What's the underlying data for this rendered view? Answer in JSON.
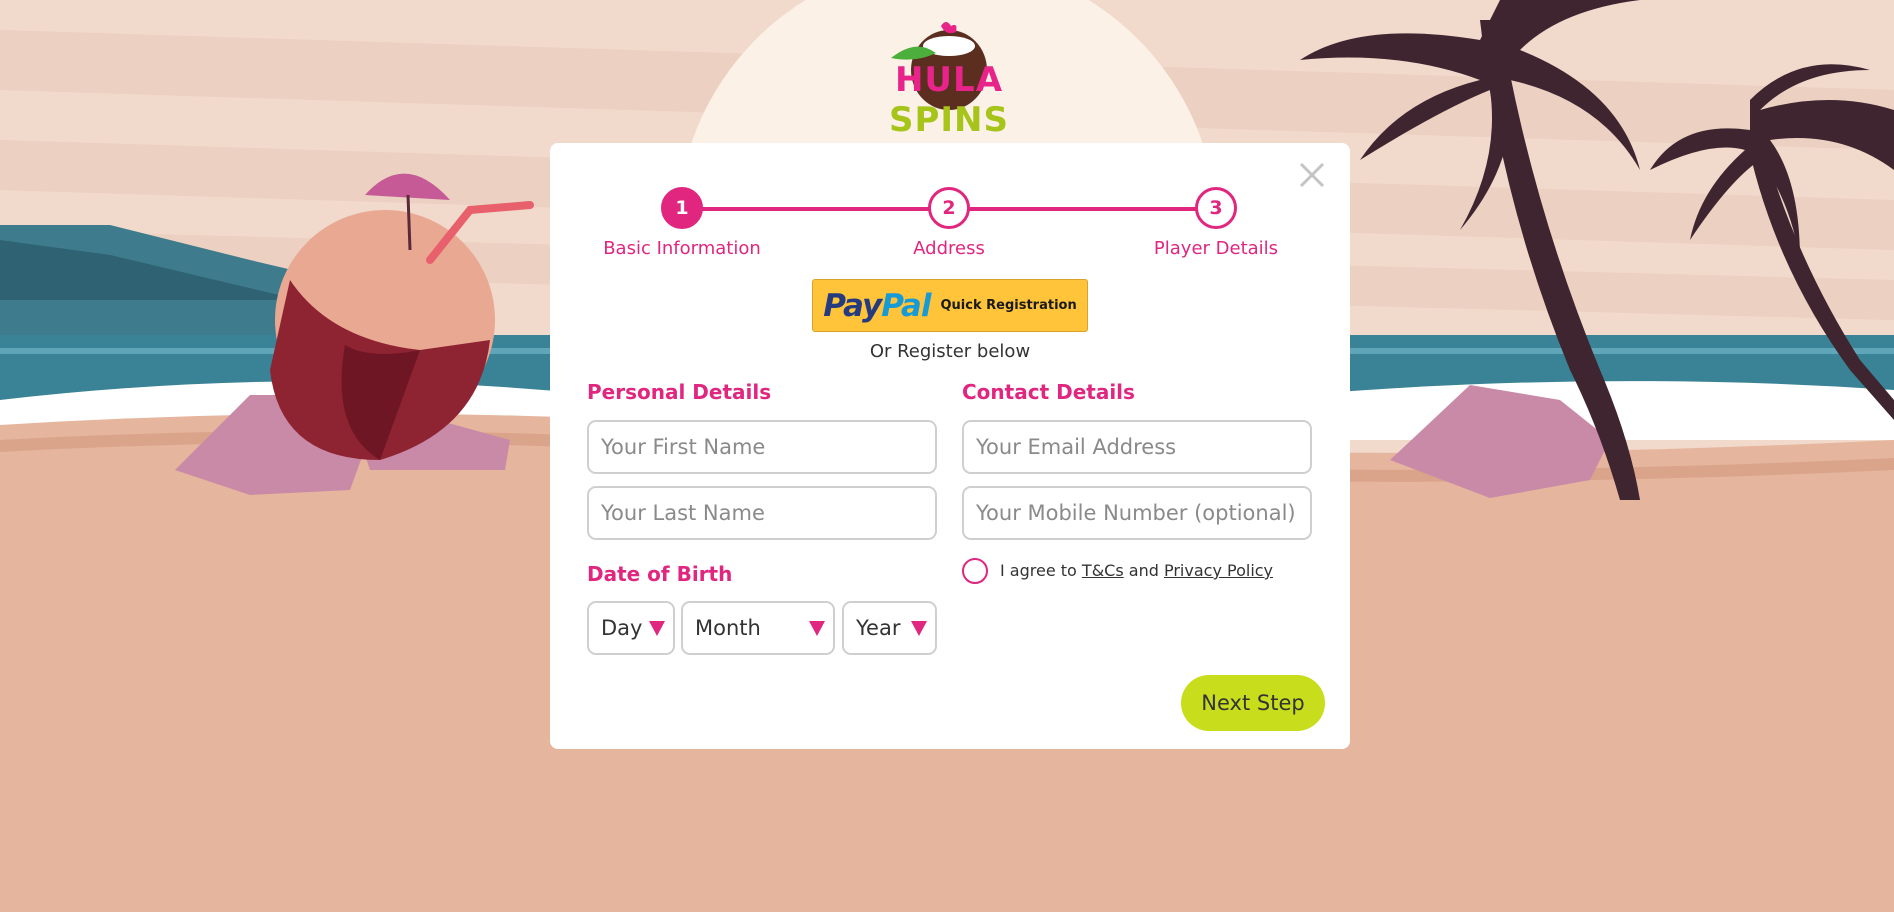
{
  "brand": {
    "logo_word_1": "HULA",
    "logo_word_2": "SPINS",
    "primary_color": "#e0267f",
    "accent_color": "#c8de1c"
  },
  "modal": {
    "close_icon": "close-icon",
    "steps": [
      {
        "number": "1",
        "label": "Basic Information",
        "active": true
      },
      {
        "number": "2",
        "label": "Address",
        "active": false
      },
      {
        "number": "3",
        "label": "Player Details",
        "active": false
      }
    ],
    "paypal": {
      "logo_pay": "Pay",
      "logo_pal": "Pal",
      "label": "Quick Registration"
    },
    "or_register": "Or Register below",
    "personal": {
      "title": "Personal Details",
      "first_name_placeholder": "Your First Name",
      "last_name_placeholder": "Your Last Name"
    },
    "dob": {
      "title": "Date of Birth",
      "day": "Day",
      "month": "Month",
      "year": "Year"
    },
    "contact": {
      "title": "Contact Details",
      "email_placeholder": "Your Email Address",
      "mobile_placeholder": "Your Mobile Number (optional)"
    },
    "agree": {
      "prefix": "I agree to",
      "terms_link": "T&Cs",
      "conjunction": "and",
      "privacy_link": "Privacy Policy"
    },
    "next_button": "Next Step"
  }
}
